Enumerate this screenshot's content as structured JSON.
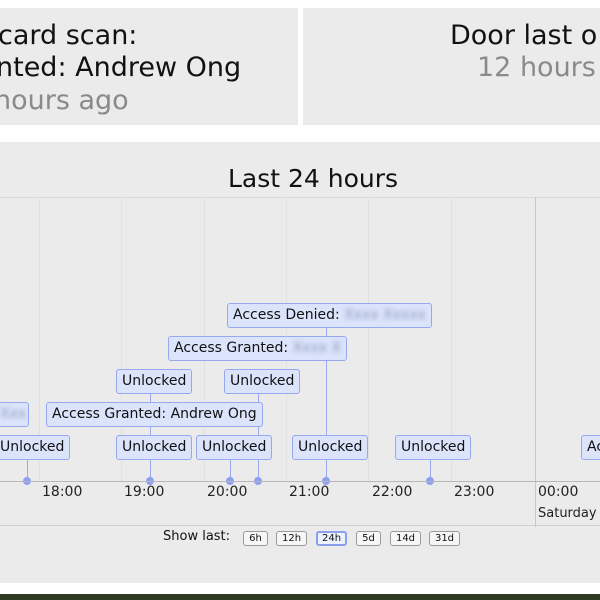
{
  "card_panel": {
    "line1": "card scan:",
    "line2": "nted: Andrew Ong",
    "line3": "hours ago"
  },
  "door_panel": {
    "line1": "Door last o",
    "line2": "12 hours"
  },
  "chart": {
    "title": "Last 24 hours",
    "ticks": [
      "18:00",
      "19:00",
      "20:00",
      "21:00",
      "22:00",
      "23:00",
      "00:00"
    ],
    "day_label": "Saturday",
    "events": {
      "e_left_unlocked": "Unlocked",
      "e_granted_andrew": "Access Granted: Andrew Ong",
      "e_1900_unlocked_low": "Unlocked",
      "e_1900_unlocked_high": "Unlocked",
      "e_2000_unlocked_low": "Unlocked",
      "e_2000_unlocked_high": "Unlocked",
      "e_access_granted_prefix": "Access Granted:",
      "e_access_denied_prefix": "Access Denied:",
      "e_2100_unlocked": "Unlocked",
      "e_2230_unlocked": "Unlocked",
      "e_right_partial": "Ac"
    },
    "range_label": "Show last:",
    "ranges": [
      "6h",
      "12h",
      "24h",
      "5d",
      "14d",
      "31d"
    ],
    "selected_range": "24h",
    "colors": {
      "event_fill": "#dbe4fb",
      "event_border": "#97a8ef",
      "marker": "#8ea0f2",
      "panel_bg": "#ebebeb"
    }
  }
}
